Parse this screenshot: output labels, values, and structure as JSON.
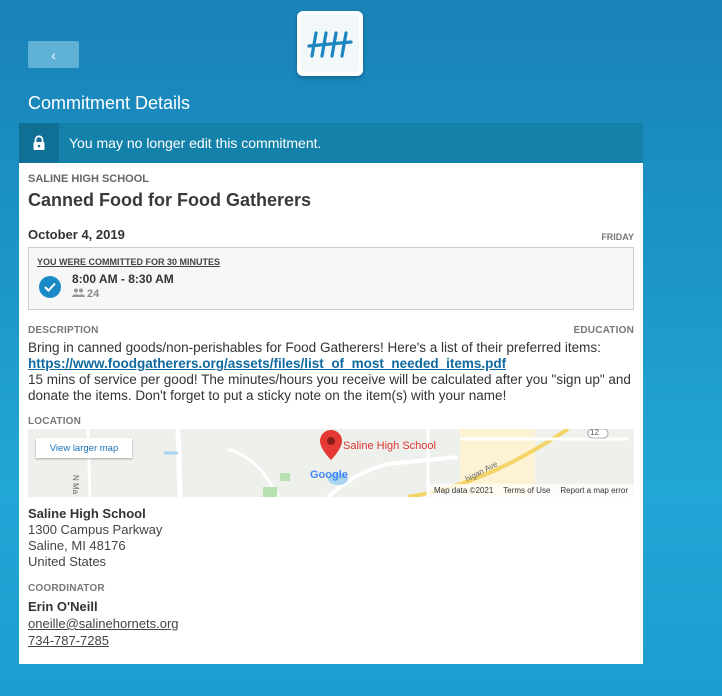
{
  "header": {
    "back_label": "‹",
    "page_title": "Commitment Details"
  },
  "notice": {
    "text": "You may no longer edit this commitment."
  },
  "event": {
    "organization": "SALINE HIGH SCHOOL",
    "title": "Canned Food for Food Gatherers",
    "date": "October 4, 2019",
    "day": "FRIDAY"
  },
  "commitment": {
    "label": "YOU WERE COMMITTED FOR 30 MINUTES",
    "time": "8:00 AM - 8:30 AM",
    "count": "24"
  },
  "description": {
    "label": "DESCRIPTION",
    "category": "EDUCATION",
    "line1": "Bring in canned goods/non-perishables for Food Gatherers! Here's a list of their preferred items:",
    "link": "https://www.foodgatherers.org/assets/files/list_of_most_needed_items.pdf",
    "line2": "15 mins of service per good! The minutes/hours you receive will be calculated after you \"sign up\" and donate the items. Don't forget to put a sticky note on the item(s) with your name!"
  },
  "location": {
    "label": "LOCATION",
    "map": {
      "view_larger": "View larger map",
      "pin_label": "Saline High School",
      "street_label": "higan Ave",
      "road_number": "12",
      "street_left": "N Ma",
      "google": "Google",
      "footer_data": "Map data ©2021",
      "footer_terms": "Terms of Use",
      "footer_report": "Report a map error"
    },
    "name": "Saline High School",
    "street": "1300 Campus Parkway",
    "city": "Saline, MI 48176",
    "country": "United States"
  },
  "coordinator": {
    "label": "COORDINATOR",
    "name": "Erin O'Neill",
    "email": "oneille@salinehornets.org",
    "phone": "734-787-7285"
  },
  "colors": {
    "accent": "#1481ab",
    "link": "#0e6aa0",
    "check": "#1a8ac6"
  }
}
